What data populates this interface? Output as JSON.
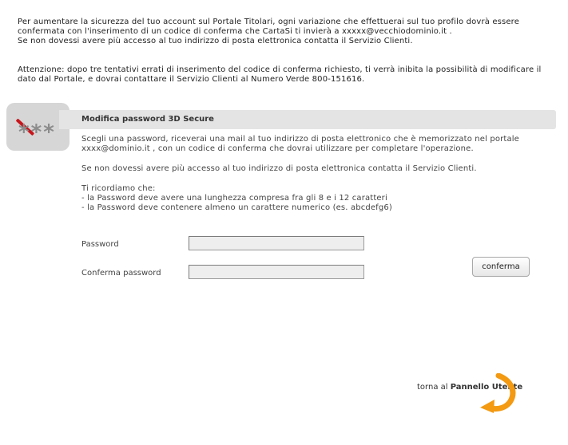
{
  "intro": {
    "security_notice": "Per aumentare la sicurezza del tuo account sul Portale Titolari, ogni variazione che effettuerai sul tuo profilo dovrà essere confermata con l'inserimento di un codice di conferma che CartaSi ti invierà a xxxxx@vecchiodominio.it .",
    "no_access_notice": "Se non dovessi avere più accesso al tuo indirizzo di posta elettronica contatta il Servizio Clienti.",
    "warning": "Attenzione: dopo tre tentativi errati di inserimento del codice di conferma richiesto, ti verrà inibita la possibilità di modificare il dato dal Portale, e dovrai contattare il Servizio Clienti al Numero Verde 800-151616."
  },
  "badge": {
    "stars": "***",
    "icon": "password-badge-icon",
    "slash_color": "#c8151b"
  },
  "section": {
    "title": "Modifica password 3D Secure",
    "instructions": "Scegli una password, riceverai una mail al tuo indirizzo di posta elettronico che è memorizzato nel portale xxxx@dominio.it , con un codice di conferma che dovrai utilizzare per completare l'operazione.",
    "no_access": "Se non dovessi avere più accesso al tuo indirizzo di posta elettronica contatta il Servizio Clienti.",
    "reminder_title": "Ti ricordiamo che:",
    "rules": [
      "- la Password deve avere una lunghezza compresa fra gli 8 e i 12 caratteri",
      "- la Password deve contenere almeno un carattere numerico (es. abcdefg6)"
    ]
  },
  "form": {
    "password_label": "Password",
    "password_value": "",
    "confirm_label": "Conferma password",
    "confirm_value": "",
    "submit_label": "conferma"
  },
  "footer": {
    "back_prefix": "torna al ",
    "back_link": "Pannello Utente",
    "arrow_icon": "orange-return-arrow-icon",
    "arrow_color": "#f39a12"
  }
}
